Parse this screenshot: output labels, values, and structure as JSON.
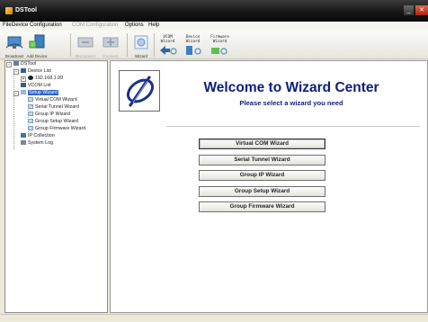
{
  "window": {
    "title": "DSTool"
  },
  "menu": [
    {
      "label": "File",
      "enabled": true
    },
    {
      "label": "Device Configuration",
      "enabled": true
    },
    {
      "label": "COM Configuration",
      "enabled": false
    },
    {
      "label": "Options",
      "enabled": true
    },
    {
      "label": "Help",
      "enabled": true
    }
  ],
  "toolbar": {
    "broadcast": "Broadcast",
    "add_device": "Add Device",
    "disabled_1": "Disconnect",
    "disabled_2": "Connect",
    "wizard": "Wizard",
    "vcom_wizard_l1": "VCOM",
    "vcom_wizard_l2": "Wizard",
    "device_wizard_l1": "Device",
    "device_wizard_l2": "Wizard",
    "firmware_wizard_l1": "Firmware",
    "firmware_wizard_l2": "Wizard"
  },
  "tree": {
    "root": "DSTool",
    "device_list": "Device List",
    "device_ip": "192.168.1.99",
    "vcom_list": "VCOM List",
    "setup_wizard": "Setup Wizard",
    "children": [
      "Virtual COM Wizard",
      "Serial Tunnel Wizard",
      "Group IP Wizard",
      "Group Setup Wizard",
      "Group Firmware Wizard"
    ],
    "ip_collection": "IP Collection",
    "system_log": "System Log"
  },
  "main": {
    "title": "Welcome to Wizard Center",
    "subtitle": "Please select a wizard you need",
    "buttons": [
      "Virtual COM Wizard",
      "Serial Tunnel Wizard",
      "Group IP Wizard",
      "Group Setup Wizard",
      "Group Firmware Wizard"
    ]
  },
  "colors": {
    "heading": "#0d1e7c",
    "selection": "#3163c5",
    "titlebar": "#141414"
  }
}
